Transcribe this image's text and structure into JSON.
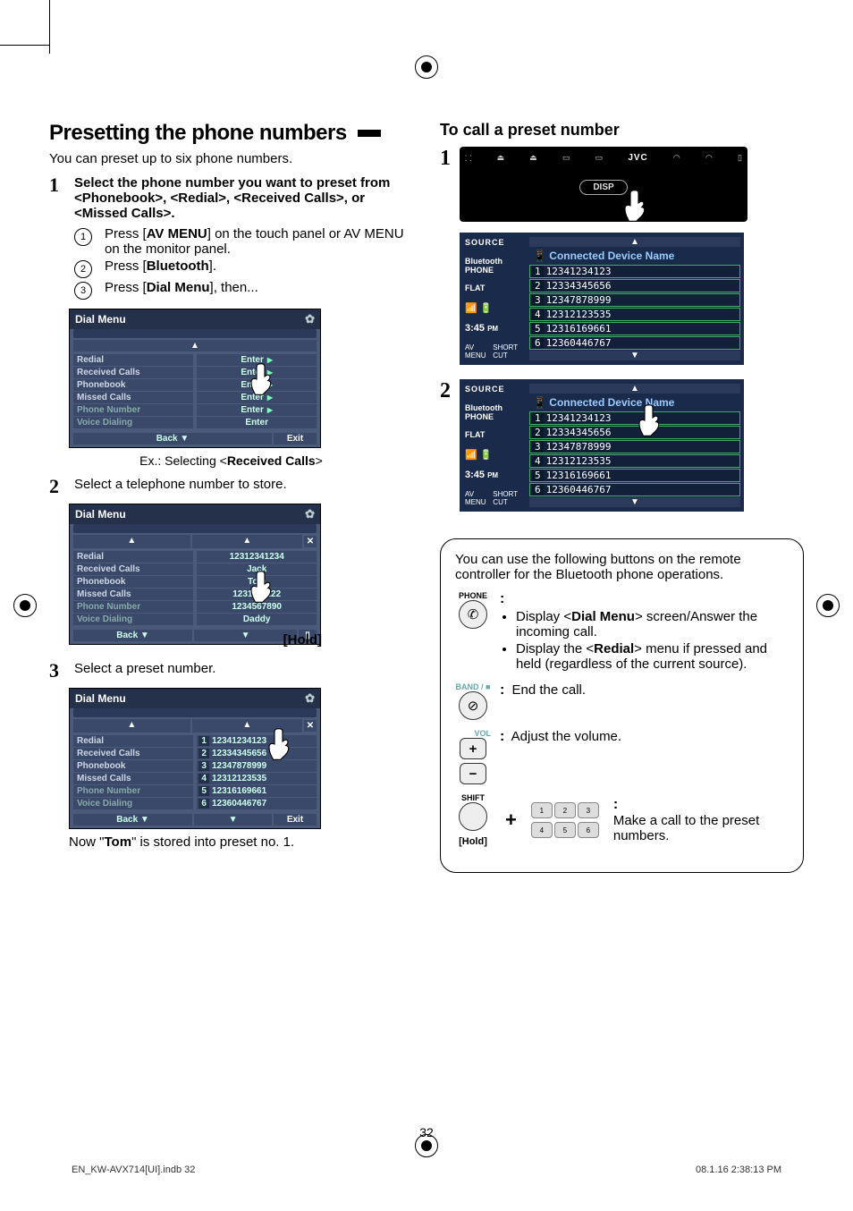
{
  "section_title": "Presetting the phone numbers",
  "intro": "You can preset up to six phone numbers.",
  "step1": {
    "lead": "Select the phone number you want to preset from <Phonebook>, <Redial>, <Received Calls>, or <Missed Calls>.",
    "sub1_a": "Press [",
    "sub1_b": "AV MENU",
    "sub1_c": "] on the touch panel or AV MENU on the monitor panel.",
    "sub2_a": "Press [",
    "sub2_b": "Bluetooth",
    "sub2_c": "].",
    "sub3_a": "Press [",
    "sub3_b": "Dial Menu",
    "sub3_c": "], then..."
  },
  "dial_menu_title": "Dial Menu",
  "menu_items": {
    "i0": "Redial",
    "i1": "Received Calls",
    "i2": "Phonebook",
    "i3": "Missed Calls",
    "i4": "Phone Number",
    "i5": "Voice Dialing"
  },
  "enter_label": "Enter",
  "back_label": "Back",
  "exit_label": "Exit",
  "caption1_a": "Ex.: Selecting <",
  "caption1_b": "Received Calls",
  "caption1_c": ">",
  "step2_lead": "Select a telephone number to store.",
  "contact_list": {
    "c0": "12312341234",
    "c1": "Jack",
    "c2": "Tom",
    "c3": "1231111222",
    "c4": "1234567890",
    "c5": "Daddy"
  },
  "hold_label": "[Hold]",
  "step3_lead": "Select a preset number.",
  "presets": {
    "p1": "12341234123",
    "p2": "12334345656",
    "p3": "12347878999",
    "p4": "12312123535",
    "p5": "12316169661",
    "p6": "12360446767"
  },
  "note_a": "Now \"",
  "note_b": "Tom",
  "note_c": "\" is stored into preset no. 1.",
  "right_title": "To call a preset number",
  "head_disp": "DISP",
  "jvc": "JVC",
  "ps_left": {
    "source": "SOURCE",
    "bt1": "Bluetooth",
    "bt2": "PHONE",
    "flat": "FLAT",
    "time": "3:45",
    "pm": "PM",
    "avmenu": "AV MENU",
    "shortcut": "SHORT CUT"
  },
  "connected": "Connected Device Name",
  "callout_intro": "You can use the following buttons on the remote controller for the Bluetooth phone operations.",
  "phone_lbl": "PHONE",
  "phone_b1_a": "Display <",
  "phone_b1_b": "Dial Menu",
  "phone_b1_c": "> screen/Answer the incoming call.",
  "phone_b2_a": "Display the <",
  "phone_b2_b": "Redial",
  "phone_b2_c": "> menu if pressed and held (regardless of the current source).",
  "band_lbl": "BAND /",
  "end_call": "End the call.",
  "vol_lbl": "VOL",
  "adjust_vol": "Adjust the volume.",
  "shift_lbl": "SHIFT",
  "hold_small": "[Hold]",
  "make_call": "Make a call to the preset numbers.",
  "page_num": "32",
  "footer_left": "EN_KW-AVX714[UI].indb   32",
  "footer_right": "08.1.16   2:38:13 PM"
}
